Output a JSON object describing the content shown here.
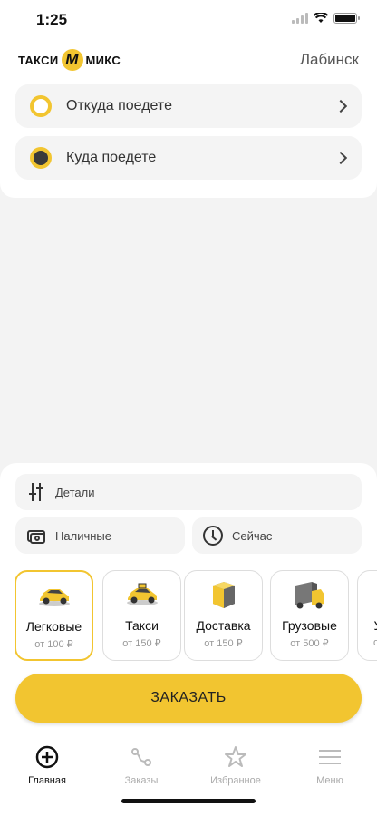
{
  "status_bar": {
    "time": "1:25"
  },
  "header": {
    "logo_left": "ТАКСИ",
    "logo_badge": "М",
    "logo_right": "МИКС",
    "city": "Лабинск"
  },
  "route": {
    "from_placeholder": "Откуда поедете",
    "to_placeholder": "Куда поедете"
  },
  "options": {
    "details": "Детали",
    "payment": "Наличные",
    "time": "Сейчас"
  },
  "tariffs": [
    {
      "title": "Легковые",
      "price": "от 100 ₽",
      "selected": true
    },
    {
      "title": "Такси",
      "price": "от 150 ₽",
      "selected": false
    },
    {
      "title": "Доставка",
      "price": "от 150 ₽",
      "selected": false
    },
    {
      "title": "Грузовые",
      "price": "от 500 ₽",
      "selected": false
    },
    {
      "title": "У",
      "price": "о",
      "selected": false
    }
  ],
  "order_button": "ЗАКАЗАТЬ",
  "tabbar": [
    {
      "label": "Главная",
      "icon": "plus-circle-icon",
      "active": true
    },
    {
      "label": "Заказы",
      "icon": "route-icon",
      "active": false
    },
    {
      "label": "Избранное",
      "icon": "star-icon",
      "active": false
    },
    {
      "label": "Меню",
      "icon": "menu-icon",
      "active": false
    }
  ],
  "colors": {
    "accent": "#F2C530",
    "background": "#F3F3F3"
  }
}
